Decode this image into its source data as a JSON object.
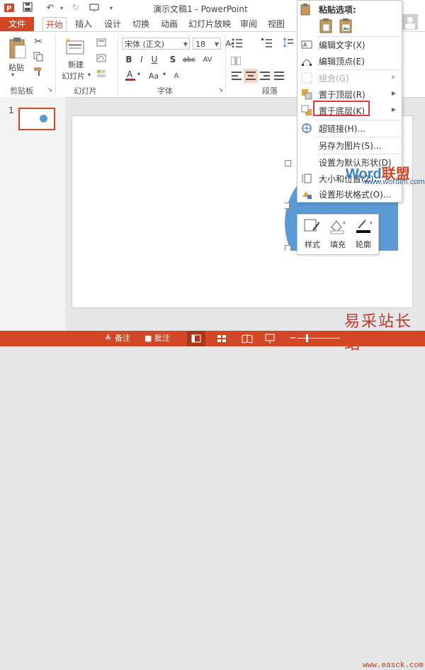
{
  "window": {
    "title": "演示文稿1 - PowerPoint",
    "qat": {
      "save_icon": "save-icon",
      "undo_icon": "undo-icon",
      "redo_icon": "redo-icon",
      "present_icon": "slideshow-icon"
    }
  },
  "tabs": {
    "file": "文件",
    "items": [
      "开始",
      "插入",
      "设计",
      "切换",
      "动画",
      "幻灯片放映",
      "审阅",
      "视图"
    ],
    "active": "开始"
  },
  "ribbon": {
    "paste_label": "粘贴",
    "new_slide_label": "新建",
    "new_slide_label2": "幻灯片",
    "font_name": "宋体 (正文)",
    "font_size": "18",
    "format_buttons": [
      "B",
      "I",
      "U",
      "S",
      "abc",
      "AV"
    ],
    "groups": {
      "clipboard": "剪贴板",
      "slides": "幻灯片",
      "font": "字体",
      "paragraph": "段落"
    }
  },
  "thumbs": {
    "slide_number": "1"
  },
  "context_menu": {
    "paste_options_title": "粘贴选项:",
    "items": [
      {
        "label": "编辑文字(X)",
        "disabled": false,
        "submenu": false
      },
      {
        "label": "编辑顶点(E)",
        "disabled": false,
        "submenu": false
      },
      {
        "label": "组合(G)",
        "disabled": true,
        "submenu": true
      },
      {
        "label": "置于顶层(R)",
        "disabled": false,
        "submenu": true
      },
      {
        "label": "置于底层(K)",
        "disabled": false,
        "submenu": true
      },
      {
        "label": "超链接(H)...",
        "disabled": false,
        "submenu": false
      },
      {
        "label": "另存为图片(S)...",
        "disabled": false,
        "submenu": false
      },
      {
        "label": "设置为默认形状(D)",
        "disabled": false,
        "submenu": false
      },
      {
        "label": "大小和位置(Z)...",
        "disabled": false,
        "submenu": false
      },
      {
        "label": "设置形状格式(O)...",
        "disabled": false,
        "submenu": false
      }
    ],
    "highlighted": "置于底层(K)"
  },
  "mini_toolbar": {
    "style": "样式",
    "fill": "填充",
    "outline": "轮廓"
  },
  "statusbar": {
    "notes": "备注",
    "comments": "批注"
  },
  "watermarks": {
    "word_brand_a": "Word",
    "word_brand_b": "联盟",
    "word_url": "www.wordlm.com",
    "site_cn": "易采站长站",
    "site_url": "www.easck.com"
  },
  "colors": {
    "accent": "#d24726",
    "shape_fill": "#5b9bd5",
    "highlight": "#e23a3a"
  }
}
